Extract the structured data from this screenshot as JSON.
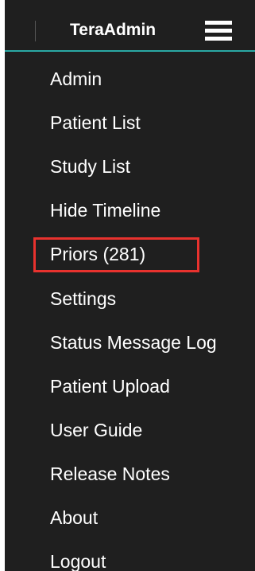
{
  "header": {
    "username": "TeraAdmin",
    "menu_icon": "hamburger-icon"
  },
  "menu": {
    "items": [
      {
        "label": "Admin"
      },
      {
        "label": "Patient List"
      },
      {
        "label": "Study List"
      },
      {
        "label": "Hide Timeline"
      },
      {
        "label": "Priors (281)",
        "highlighted": true
      },
      {
        "label": "Settings"
      },
      {
        "label": "Status Message Log"
      },
      {
        "label": "Patient Upload"
      },
      {
        "label": "User Guide"
      },
      {
        "label": "Release Notes"
      },
      {
        "label": "About"
      },
      {
        "label": "Logout"
      }
    ]
  },
  "colors": {
    "background": "#1f1f1f",
    "accent_line": "#2aa8a4",
    "highlight_border": "#e8322e",
    "text": "#ffffff"
  }
}
